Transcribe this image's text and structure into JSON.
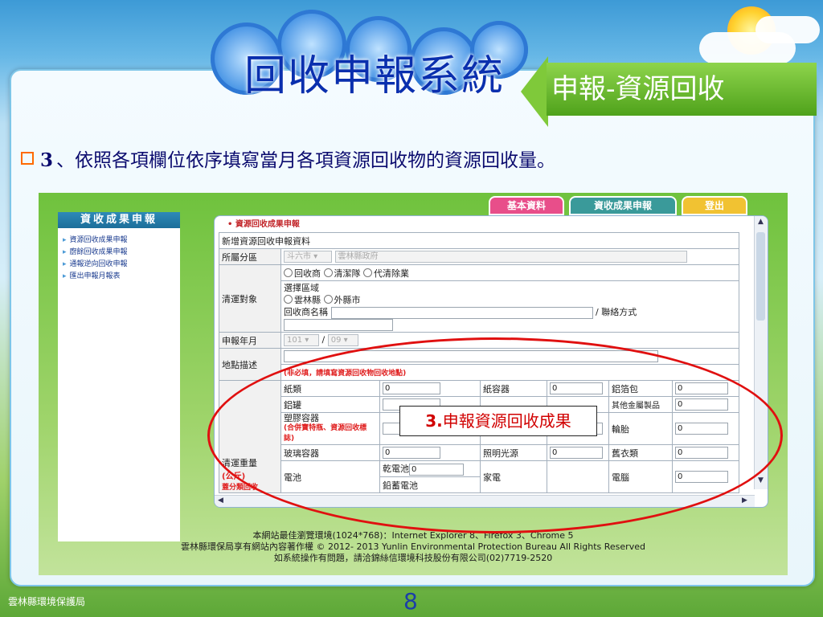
{
  "slide": {
    "title": "回收申報系統",
    "subtitle": "申報-資源回收",
    "bullet_number": "3",
    "bullet_text": "、依照各項欄位依序填寫當月各項資源回收物的資源回收量。",
    "organization": "雲林縣環境保護局",
    "page_number": "8",
    "callout": {
      "num": "3.",
      "text": "申報資源回收成果"
    }
  },
  "app": {
    "tabs": [
      "基本資料",
      "資收成果申報",
      "登出"
    ],
    "sidebar": {
      "title": "資收成果申報",
      "items": [
        "資源回收成果申報",
        "廚餘回收成果申報",
        "通報逆向回收申報",
        "匯出申報月報表"
      ]
    },
    "form": {
      "section_title": "資源回收成果申報",
      "form_title": "新增資源回收申報資料",
      "area_label": "所屬分區",
      "area_value1": "斗六市",
      "area_value2": "雲林縣政府",
      "target_label": "清運對象",
      "target_options": [
        "回收商",
        "清潔隊",
        "代清除業"
      ],
      "select_region_label": "選擇區域",
      "region_options": [
        "雲林縣",
        "外縣市"
      ],
      "vendor_label": "回收商名稱",
      "contact_label": "/ 聯絡方式",
      "year_month_label": "申報年月",
      "year_value": "101",
      "month_value": "09",
      "address_label": "地點描述",
      "address_note": "(非必填，請填寫資源回收物回收地點)",
      "weight_label": "清運重量",
      "weight_unit": "(公斤)",
      "weight_note": "蓋分類回收",
      "items": {
        "paper_label": "紙類",
        "paper_value": "0",
        "paper_container_label": "紙容器",
        "paper_container_value": "0",
        "alu_foil_label": "鋁箔包",
        "alu_foil_value": "0",
        "alu_can_label": "鋁罐",
        "other_metal_label": "其他金屬製品",
        "other_metal_value": "0",
        "plastic_label": "塑膠容器",
        "plastic_note": "(含寶特瓶、資源回收標誌)",
        "plastic_note2": "(合併寶特瓶、資源回收標誌)",
        "plastic2_label": "塑膠",
        "tire_label": "輪胎",
        "tire_value": "0",
        "glass_label": "玻璃容器",
        "glass_value": "0",
        "lamp_label": "照明光源",
        "lamp_value": "0",
        "clothes_label": "舊衣類",
        "clothes_value": "0",
        "battery_label": "電池",
        "dry_battery_label": "乾電池",
        "dry_battery_value": "0",
        "lead_battery_label": "鉛蓄電池",
        "appliance_label": "家電",
        "computer_label": "電腦",
        "computer_value": "0"
      }
    },
    "footer": [
      "本網站最佳瀏覽環境(1024*768)：Internet Explorer 8、Firefox 3、Chrome 5",
      "雲林縣環保局享有網站內容著作權 © 2012- 2013 Yunlin Environmental Protection Bureau All Rights Reserved",
      "如系統操作有問題，請洽錦絲信環境科技股份有限公司(02)7719-2520"
    ]
  },
  "colors": {
    "title": "#0a2fae",
    "subtitle_bg": "#5eb12a",
    "callout_text": "#d10000",
    "ellipse": "#e01010"
  }
}
